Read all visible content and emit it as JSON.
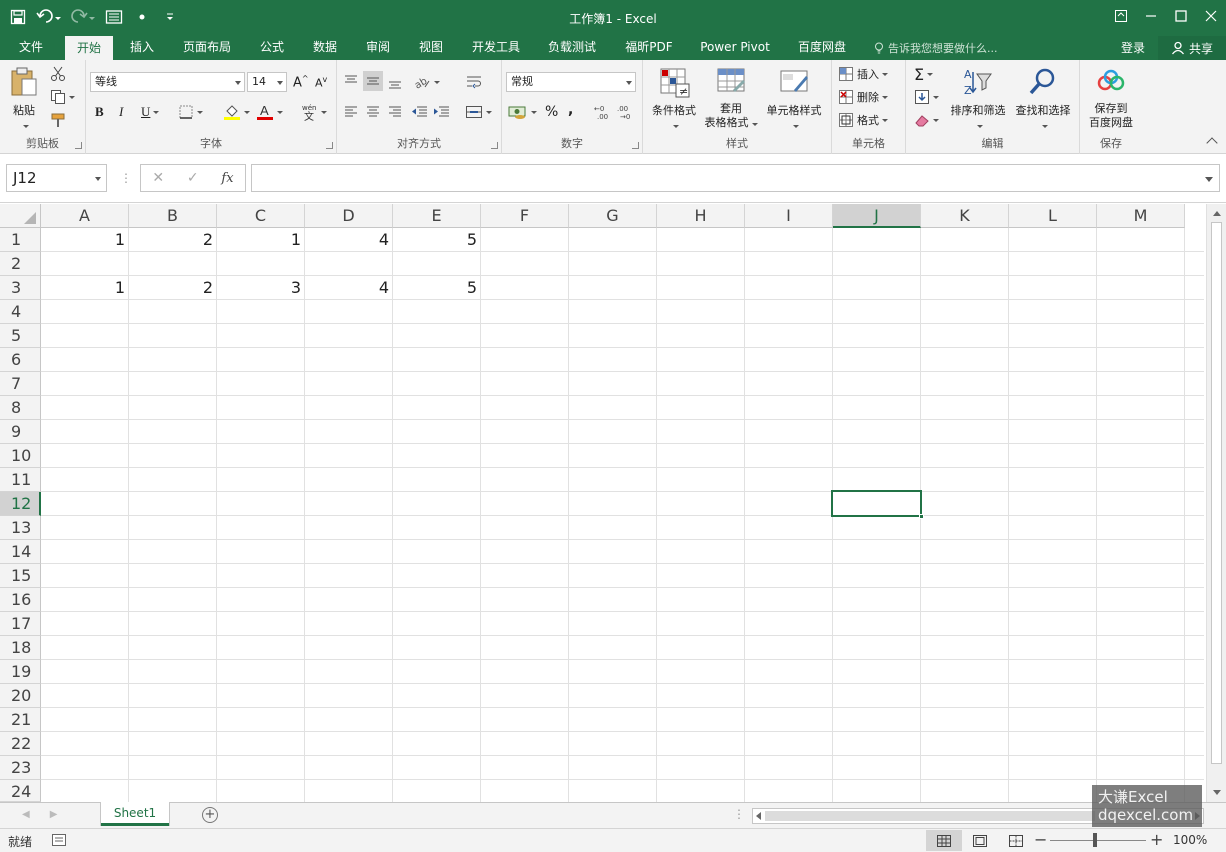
{
  "window": {
    "title": "工作簿1 - Excel"
  },
  "tabs": [
    {
      "label": "文件",
      "active": false
    },
    {
      "label": "开始",
      "active": true
    },
    {
      "label": "插入",
      "active": false
    },
    {
      "label": "页面布局",
      "active": false
    },
    {
      "label": "公式",
      "active": false
    },
    {
      "label": "数据",
      "active": false
    },
    {
      "label": "审阅",
      "active": false
    },
    {
      "label": "视图",
      "active": false
    },
    {
      "label": "开发工具",
      "active": false
    },
    {
      "label": "负载测试",
      "active": false
    },
    {
      "label": "福昕PDF",
      "active": false
    },
    {
      "label": "Power Pivot",
      "active": false
    },
    {
      "label": "百度网盘",
      "active": false
    }
  ],
  "tellme": "告诉我您想要做什么...",
  "account": {
    "login": "登录",
    "share": "共享"
  },
  "ribbon": {
    "clipboard": {
      "label": "剪贴板",
      "paste": "粘贴"
    },
    "font": {
      "label": "字体",
      "name": "等线",
      "size": "14",
      "bold": "B",
      "italic": "I",
      "underline": "U"
    },
    "alignment": {
      "label": "对齐方式"
    },
    "number": {
      "label": "数字",
      "format": "常规",
      "percent": "%",
      "comma": ","
    },
    "styles": {
      "label": "样式",
      "conditional": "条件格式",
      "table_line1": "套用",
      "table_line2": "表格格式",
      "cell_styles": "单元格样式"
    },
    "cells": {
      "label": "单元格",
      "insert": "插入",
      "delete": "删除",
      "format": "格式"
    },
    "editing": {
      "label": "编辑",
      "sort": "排序和筛选",
      "find": "查找和选择"
    },
    "save": {
      "label": "保存",
      "line1": "保存到",
      "line2": "百度网盘"
    }
  },
  "formula_bar": {
    "name_box": "J12",
    "fx": "fx",
    "value": ""
  },
  "columns": [
    "A",
    "B",
    "C",
    "D",
    "E",
    "F",
    "G",
    "H",
    "I",
    "J",
    "K",
    "L",
    "M"
  ],
  "rows": [
    "1",
    "2",
    "3",
    "4",
    "5",
    "6",
    "7",
    "8",
    "9",
    "10",
    "11",
    "12",
    "13",
    "14",
    "15",
    "16",
    "17",
    "18",
    "19",
    "20",
    "21",
    "22",
    "23",
    "24"
  ],
  "active_cell": {
    "col": "J",
    "row": "12"
  },
  "cells": [
    {
      "ref": "A1",
      "value": "1"
    },
    {
      "ref": "B1",
      "value": "2"
    },
    {
      "ref": "C1",
      "value": "1"
    },
    {
      "ref": "D1",
      "value": "4"
    },
    {
      "ref": "E1",
      "value": "5"
    },
    {
      "ref": "A3",
      "value": "1"
    },
    {
      "ref": "B3",
      "value": "2"
    },
    {
      "ref": "C3",
      "value": "3"
    },
    {
      "ref": "D3",
      "value": "4"
    },
    {
      "ref": "E3",
      "value": "5"
    }
  ],
  "sheets": [
    {
      "name": "Sheet1",
      "active": true
    }
  ],
  "status": {
    "ready": "就绪",
    "zoom": "100%"
  },
  "watermark": {
    "line1": "大谦Excel",
    "line2": "dqexcel.com"
  },
  "colors": {
    "accent": "#217346",
    "ribbon_bg": "#f3f3f3",
    "grid": "#e1e1e1"
  }
}
